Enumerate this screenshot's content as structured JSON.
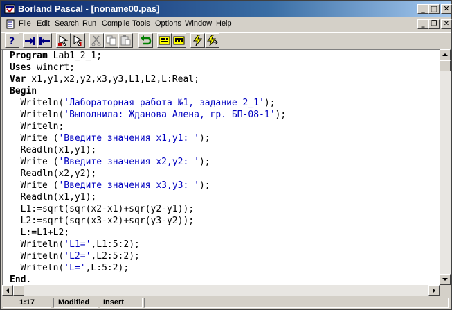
{
  "window": {
    "title": "Borland Pascal - [noname00.pas]",
    "minimize_glyph": "_",
    "maximize_glyph": "□",
    "close_glyph": "✕"
  },
  "menu": {
    "items": [
      "File",
      "Edit",
      "Search",
      "Run",
      "Compile",
      "Tools",
      "Options",
      "Window",
      "Help"
    ],
    "mdi_minimize": "_",
    "mdi_restore": "❐",
    "mdi_close": "✕"
  },
  "toolbar": {
    "buttons": [
      "help-icon",
      "open-file-icon",
      "save-file-icon",
      "find-icon",
      "find-next-icon",
      "cut-icon",
      "copy-icon",
      "paste-icon",
      "undo-icon",
      "compile-icon",
      "make-icon",
      "run-icon",
      "step-over-icon"
    ]
  },
  "editor": {
    "lines": [
      [
        {
          "t": "Program",
          "c": "kw"
        },
        {
          "t": " Lab1_2_1;",
          "c": ""
        }
      ],
      [
        {
          "t": "Uses",
          "c": "kw"
        },
        {
          "t": " wincrt;",
          "c": ""
        }
      ],
      [
        {
          "t": "Var",
          "c": "kw"
        },
        {
          "t": " x1,y1,x2,y2,x3,y3,L1,L2,L:Real;",
          "c": ""
        }
      ],
      [
        {
          "t": "Begin",
          "c": "kw"
        }
      ],
      [
        {
          "t": "  Writeln(",
          "c": ""
        },
        {
          "t": "'Лабораторная работа №1, задание 2_1'",
          "c": "str"
        },
        {
          "t": ");",
          "c": ""
        }
      ],
      [
        {
          "t": "  Writeln(",
          "c": ""
        },
        {
          "t": "'Выполнила: Жданова Алена, гр. БП-08-1'",
          "c": "str"
        },
        {
          "t": ");",
          "c": ""
        }
      ],
      [
        {
          "t": "  Writeln;",
          "c": ""
        }
      ],
      [
        {
          "t": "  Write (",
          "c": ""
        },
        {
          "t": "'Введите значения x1,y1: '",
          "c": "str"
        },
        {
          "t": ");",
          "c": ""
        }
      ],
      [
        {
          "t": "  Readln(x1,y1);",
          "c": ""
        }
      ],
      [
        {
          "t": "  Write (",
          "c": ""
        },
        {
          "t": "'Введите значения x2,y2: '",
          "c": "str"
        },
        {
          "t": ");",
          "c": ""
        }
      ],
      [
        {
          "t": "  Readln(x2,y2);",
          "c": ""
        }
      ],
      [
        {
          "t": "  Write (",
          "c": ""
        },
        {
          "t": "'Введите значения x3,y3: '",
          "c": "str"
        },
        {
          "t": ");",
          "c": ""
        }
      ],
      [
        {
          "t": "  Readln(x1,y1);",
          "c": ""
        }
      ],
      [
        {
          "t": "  L1:=sqrt(sqr(x2-x1)+sqr(y2-y1));",
          "c": ""
        }
      ],
      [
        {
          "t": "  L2:=sqrt(sqr(x3-x2)+sqr(y3-y2));",
          "c": ""
        }
      ],
      [
        {
          "t": "  L:=L1+L2;",
          "c": ""
        }
      ],
      [
        {
          "t": "  Writeln(",
          "c": ""
        },
        {
          "t": "'L1='",
          "c": "str"
        },
        {
          "t": ",L1:5:2);",
          "c": ""
        }
      ],
      [
        {
          "t": "  Writeln(",
          "c": ""
        },
        {
          "t": "'L2='",
          "c": "str"
        },
        {
          "t": ",L2:5:2);",
          "c": ""
        }
      ],
      [
        {
          "t": "  Writeln(",
          "c": ""
        },
        {
          "t": "'L='",
          "c": "str"
        },
        {
          "t": ",L:5:2);",
          "c": ""
        }
      ],
      [
        {
          "t": "End",
          "c": "kw"
        },
        {
          "t": ".",
          "c": ""
        }
      ]
    ]
  },
  "status": {
    "position": "1:17",
    "modified": "Modified",
    "mode": "Insert"
  },
  "colors": {
    "title_gradient_start": "#0a246a",
    "title_gradient_end": "#a6caf0",
    "string_literal": "#0000c0",
    "editor_bg": "#ffffff",
    "chrome": "#d4d0c8"
  }
}
